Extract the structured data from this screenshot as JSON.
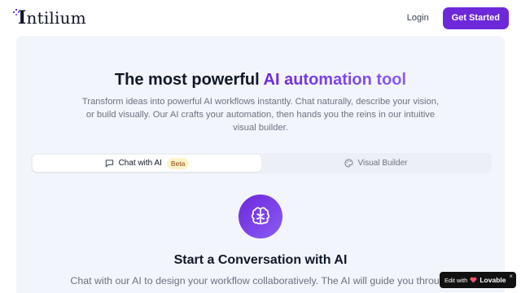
{
  "header": {
    "logo": {
      "cap": "I",
      "rest": "ntilium"
    },
    "login_label": "Login",
    "cta_label": "Get Started"
  },
  "hero": {
    "title_plain": "The most powerful ",
    "title_accent": "AI automation tool",
    "subtitle": "Transform ideas into powerful AI workflows instantly. Chat naturally, describe your vision, or build visually. Our AI crafts your automation, then hands you the reins in our intuitive visual builder."
  },
  "tabs": [
    {
      "label": "Chat with AI",
      "badge": "Beta",
      "icon": "chat-bubble-icon",
      "active": true
    },
    {
      "label": "Visual Builder",
      "icon": "palette-icon",
      "active": false
    }
  ],
  "chat_section": {
    "icon": "brain-icon",
    "title": "Start a Conversation with AI",
    "description": "Chat with our AI to design your workflow collaboratively. The AI will guide you through"
  },
  "lovable_badge": {
    "prefix": "Edit with",
    "brand": "Lovable",
    "close": "×"
  },
  "colors": {
    "accent": "#6d28d9",
    "accent_light": "#8b5cf6",
    "panel_bg": "#f3f5fc",
    "beta_bg": "#fef3c7"
  }
}
